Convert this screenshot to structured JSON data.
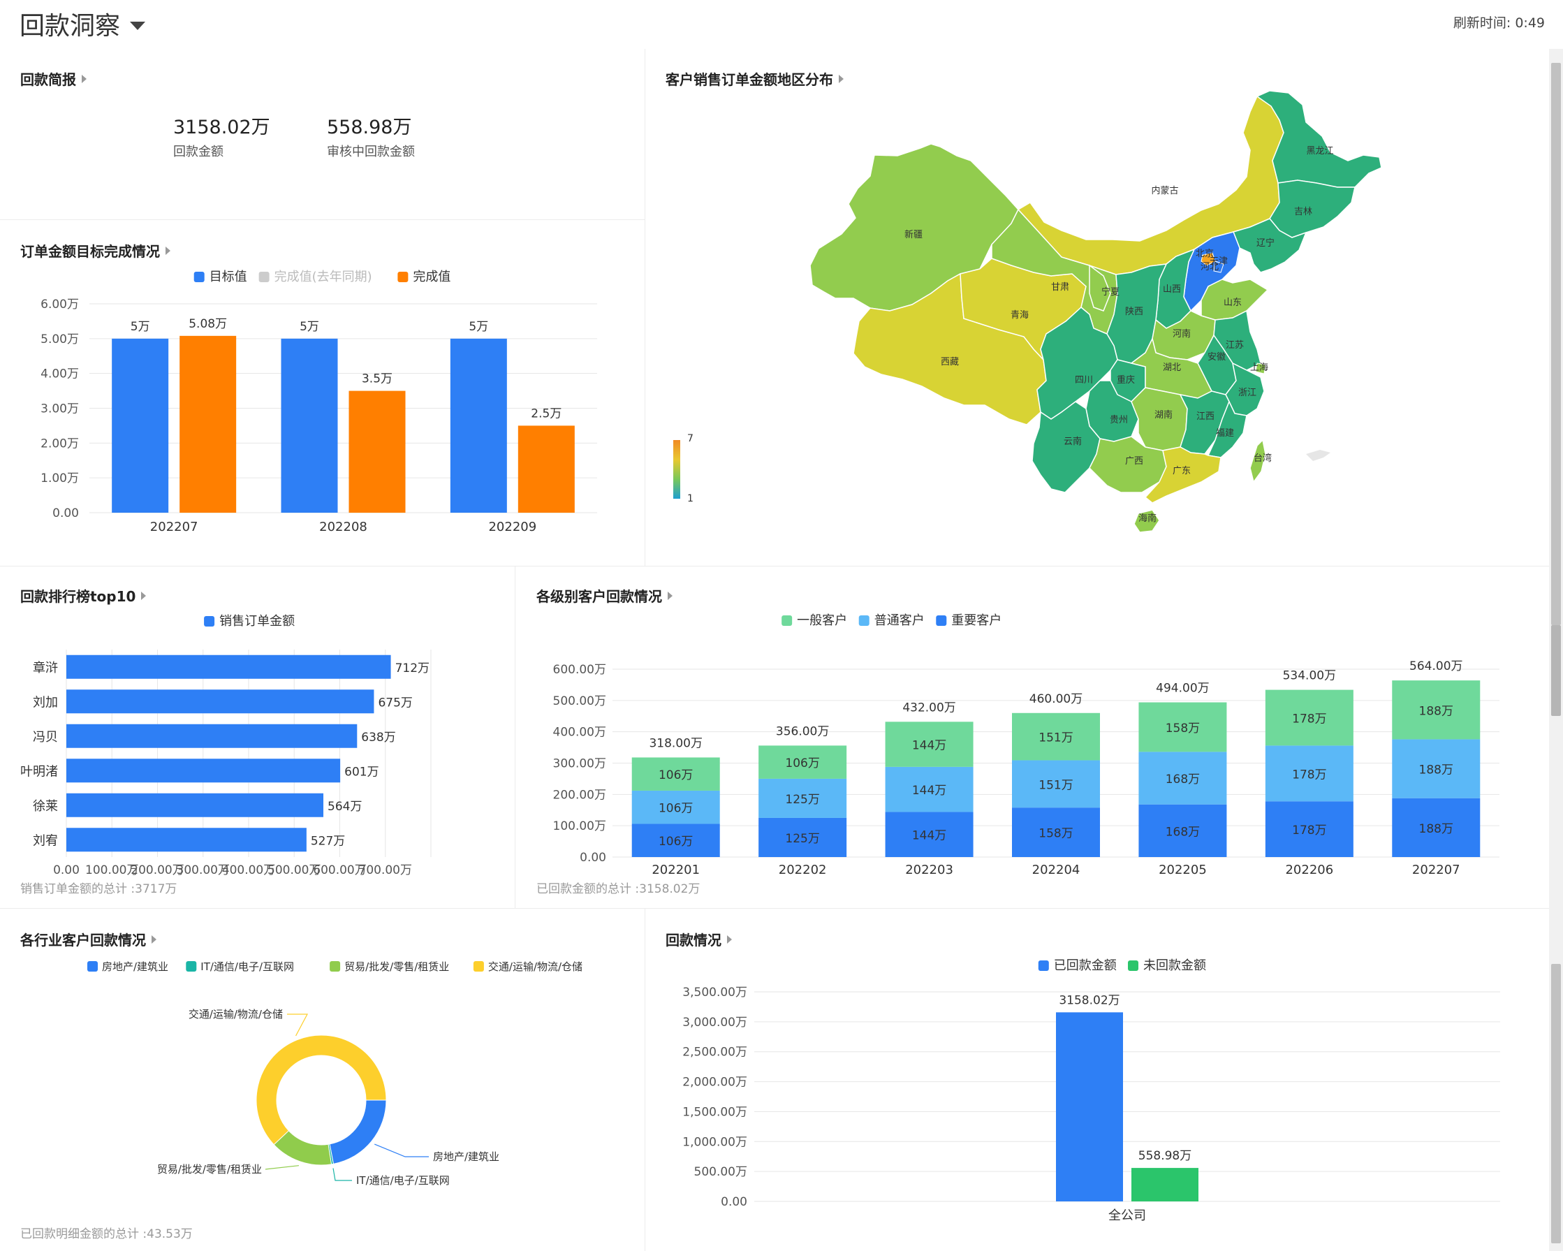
{
  "header": {
    "title": "回款洞察",
    "refresh_label": "刷新时间:",
    "refresh_time": "0:49"
  },
  "summary": {
    "title": "回款简报",
    "items": [
      {
        "value": "3158.02万",
        "label": "回款金额"
      },
      {
        "value": "558.98万",
        "label": "审核中回款金额"
      }
    ]
  },
  "map": {
    "title": "客户销售订单金额地区分布",
    "visualmap_max": "7",
    "visualmap_min": "1",
    "provinces": [
      "黑龙江",
      "吉林",
      "辽宁",
      "内蒙古",
      "新疆",
      "北京",
      "天津",
      "河北",
      "山西",
      "山东",
      "甘肃",
      "宁夏",
      "陕西",
      "青海",
      "西藏",
      "河南",
      "江苏",
      "安徽",
      "上海",
      "四川",
      "重庆",
      "湖北",
      "浙江",
      "贵州",
      "湖南",
      "江西",
      "云南",
      "福建",
      "台湾",
      "广西",
      "广东",
      "海南"
    ]
  },
  "target_section": {
    "title": "订单金额目标完成情况"
  },
  "ranking_section": {
    "title": "回款排行榜top10",
    "footer": "销售订单金额的总计 :3717万"
  },
  "level_section": {
    "title": "各级别客户回款情况",
    "footer": "已回款金额的总计 :3158.02万"
  },
  "industry_section": {
    "title": "各行业客户回款情况",
    "footer": "已回款明细金额的总计 :43.53万"
  },
  "payment_section": {
    "title": "回款情况"
  },
  "colors": {
    "blue": "#2e7ff5",
    "orange": "#ff7f00",
    "gray": "#cccccc",
    "green_light": "#6fd99b",
    "sky": "#5bb8f7",
    "green": "#2bc56b",
    "yellow": "#fdcf2c",
    "teal": "#1ab5a6",
    "lime": "#90cc4c"
  },
  "chart_data": [
    {
      "id": "target",
      "type": "bar",
      "categories": [
        "202207",
        "202208",
        "202209"
      ],
      "series": [
        {
          "name": "目标值",
          "values": [
            5,
            5,
            5
          ],
          "labels": [
            "5万",
            "5万",
            "5万"
          ]
        },
        {
          "name": "完成值(去年同期)",
          "values": [
            null,
            null,
            null
          ],
          "labels": []
        },
        {
          "name": "完成值",
          "values": [
            5.08,
            3.5,
            2.5
          ],
          "labels": [
            "5.08万",
            "3.5万",
            "2.5万"
          ]
        }
      ],
      "yticks": [
        "0.00",
        "1.00万",
        "2.00万",
        "3.00万",
        "4.00万",
        "5.00万",
        "6.00万"
      ],
      "ylim": [
        0,
        6
      ],
      "legend": "top-center"
    },
    {
      "id": "ranking",
      "type": "bar",
      "orientation": "horizontal",
      "categories": [
        "章浒",
        "刘加",
        "冯贝",
        "叶明渚",
        "徐莱",
        "刘宥"
      ],
      "series": [
        {
          "name": "销售订单金额",
          "values": [
            712,
            675,
            638,
            601,
            564,
            527
          ],
          "labels": [
            "712万",
            "675万",
            "638万",
            "601万",
            "564万",
            "527万"
          ]
        }
      ],
      "xticks": [
        "0.00",
        "100.00万",
        "200.00万",
        "300.00万",
        "400.00万",
        "500.00万",
        "600.00万",
        "700.00万"
      ],
      "xlim": [
        0,
        800
      ],
      "legend": "top-center"
    },
    {
      "id": "level",
      "type": "bar",
      "stacked": true,
      "categories": [
        "202201",
        "202202",
        "202203",
        "202204",
        "202205",
        "202206",
        "202207"
      ],
      "series": [
        {
          "name": "重要客户",
          "values": [
            106,
            125,
            144,
            158,
            168,
            178,
            188
          ]
        },
        {
          "name": "普通客户",
          "values": [
            106,
            125,
            144,
            151,
            168,
            178,
            188
          ]
        },
        {
          "name": "一般客户",
          "values": [
            106,
            106,
            144,
            151,
            158,
            178,
            188
          ]
        }
      ],
      "totals": [
        "318.00万",
        "356.00万",
        "432.00万",
        "460.00万",
        "494.00万",
        "534.00万",
        "564.00万"
      ],
      "legend_order": [
        "一般客户",
        "普通客户",
        "重要客户"
      ],
      "yticks": [
        "0.00",
        "100.00万",
        "200.00万",
        "300.00万",
        "400.00万",
        "500.00万",
        "600.00万"
      ],
      "ylim": [
        0,
        600
      ],
      "legend": "top-center"
    },
    {
      "id": "industry",
      "type": "pie",
      "donut": true,
      "series": [
        {
          "name": "房地产/建筑业",
          "value": 0.22
        },
        {
          "name": "IT/通信/电子/互联网",
          "value": 0.005
        },
        {
          "name": "贸易/批发/零售/租赁业",
          "value": 0.155
        },
        {
          "name": "交通/运输/物流/仓储",
          "value": 0.62
        }
      ],
      "legend": "top-center"
    },
    {
      "id": "payment",
      "type": "bar",
      "categories": [
        "全公司"
      ],
      "series": [
        {
          "name": "已回款金额",
          "values": [
            3158.02
          ],
          "labels": [
            "3158.02万"
          ]
        },
        {
          "name": "未回款金额",
          "values": [
            558.98
          ],
          "labels": [
            "558.98万"
          ]
        }
      ],
      "yticks": [
        "0.00",
        "500.00万",
        "1,000.00万",
        "1,500.00万",
        "2,000.00万",
        "2,500.00万",
        "3,000.00万",
        "3,500.00万"
      ],
      "ylim": [
        0,
        3500
      ],
      "legend": "top-center"
    }
  ]
}
